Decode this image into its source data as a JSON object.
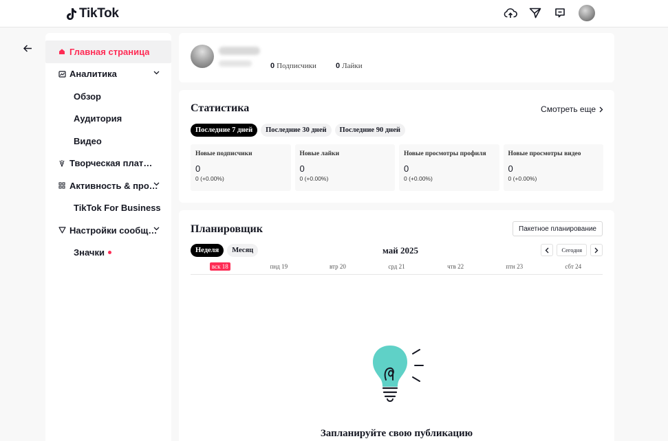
{
  "app": {
    "name": "TikTok"
  },
  "sidebar": {
    "items": [
      {
        "label": "Главная страница",
        "icon": "home-icon",
        "active": true
      },
      {
        "label": "Аналитика",
        "icon": "analytics-icon",
        "expandable": true
      },
      {
        "label": "Обзор",
        "sub": true
      },
      {
        "label": "Аудитория",
        "sub": true
      },
      {
        "label": "Видео",
        "sub": true
      },
      {
        "label": "Творческая платформа",
        "icon": "creative-icon"
      },
      {
        "label": "Активность & продвижение",
        "icon": "grid-icon",
        "expandable": true
      },
      {
        "label": "TikTok For Business",
        "sub": true
      },
      {
        "label": "Настройки сообщений",
        "icon": "filter-icon",
        "expandable": true
      },
      {
        "label": "Значки",
        "sub": true,
        "dot": true
      }
    ]
  },
  "profile": {
    "followers_count": "0",
    "followers_label": "Подписчики",
    "likes_count": "0",
    "likes_label": "Лайки"
  },
  "stats": {
    "title": "Статистика",
    "see_more": "Смотреть еще",
    "periods": [
      "Последние 7 дней",
      "Последние 30 дней",
      "Последние 90 дней"
    ],
    "active_period": 0,
    "metrics": [
      {
        "label": "Новые подписчики",
        "value": "0",
        "delta": "0  (+0.00%)"
      },
      {
        "label": "Новые лайки",
        "value": "0",
        "delta": "0  (+0.00%)"
      },
      {
        "label": "Новые просмотры профиля",
        "value": "0",
        "delta": "0  (+0.00%)"
      },
      {
        "label": "Новые просмотры видео",
        "value": "0",
        "delta": "0  (+0.00%)"
      }
    ]
  },
  "planner": {
    "title": "Планировщик",
    "batch_label": "Пакетное планирование",
    "views": [
      "Неделя",
      "Месяц"
    ],
    "active_view": 0,
    "month": "май 2025",
    "today_label": "Сегодня",
    "days": [
      "вск 18",
      "пнд 19",
      "втр 20",
      "срд 21",
      "чтв 22",
      "птн 23",
      "сбт 24"
    ],
    "today_index": 0,
    "empty_title": "Запланируйте свою публикацию"
  },
  "colors": {
    "accent": "#fe2c55",
    "bulb": "#5fd1c7",
    "text": "#161823"
  }
}
